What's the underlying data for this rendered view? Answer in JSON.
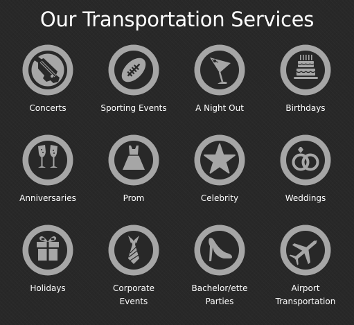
{
  "page": {
    "title": "Our Transportation Services"
  },
  "colors": {
    "background": "#282828",
    "icon_gray": "#a6a6a6",
    "icon_cutout": "#282828",
    "text": "#ffffff"
  },
  "services": [
    {
      "label": "Concerts",
      "icon": "guitar-icon"
    },
    {
      "label": "Sporting Events",
      "icon": "football-icon"
    },
    {
      "label": "A Night Out",
      "icon": "martini-glass-icon"
    },
    {
      "label": "Birthdays",
      "icon": "birthday-cake-icon"
    },
    {
      "label": "Anniversaries",
      "icon": "champagne-glasses-icon"
    },
    {
      "label": "Prom",
      "icon": "prom-dress-icon"
    },
    {
      "label": "Celebrity",
      "icon": "star-icon"
    },
    {
      "label": "Weddings",
      "icon": "wedding-rings-icon"
    },
    {
      "label": "Holidays",
      "icon": "gift-box-icon"
    },
    {
      "label": "Corporate\nEvents",
      "icon": "necktie-icon"
    },
    {
      "label": "Bachelor/ette\nParties",
      "icon": "high-heel-shoe-icon"
    },
    {
      "label": "Airport\nTransportation",
      "icon": "airplane-icon"
    }
  ]
}
